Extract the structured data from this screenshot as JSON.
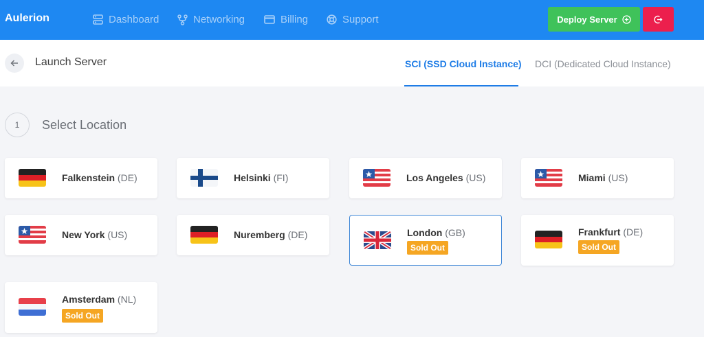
{
  "nav": {
    "brand": "Aulerion",
    "items": [
      {
        "label": "Dashboard",
        "icon": "dashboard-icon"
      },
      {
        "label": "Networking",
        "icon": "networking-icon"
      },
      {
        "label": "Billing",
        "icon": "billing-icon"
      },
      {
        "label": "Support",
        "icon": "support-icon"
      }
    ],
    "deploy_label": "Deploy Server",
    "accent": "#1e88f2"
  },
  "header": {
    "title": "Launch Server",
    "tabs": [
      {
        "label": "SCI (SSD Cloud Instance)",
        "active": true
      },
      {
        "label": "DCI (Dedicated Cloud Instance)",
        "active": false
      }
    ]
  },
  "step": {
    "number": "1",
    "title": "Select Location"
  },
  "locations": [
    {
      "city": "Falkenstein",
      "country": "(DE)",
      "flag": "DE",
      "badge": ""
    },
    {
      "city": "Helsinki",
      "country": "(FI)",
      "flag": "FI",
      "badge": ""
    },
    {
      "city": "Los Angeles",
      "country": "(US)",
      "flag": "US",
      "badge": ""
    },
    {
      "city": "Miami",
      "country": "(US)",
      "flag": "US",
      "badge": ""
    },
    {
      "city": "New York",
      "country": "(US)",
      "flag": "US",
      "badge": ""
    },
    {
      "city": "Nuremberg",
      "country": "(DE)",
      "flag": "DE",
      "badge": ""
    },
    {
      "city": "London",
      "country": "(GB)",
      "flag": "GB",
      "badge": "Sold Out",
      "selected": true
    },
    {
      "city": "Frankfurt",
      "country": "(DE)",
      "flag": "DE",
      "badge": "Sold Out"
    },
    {
      "city": "Amsterdam",
      "country": "(NL)",
      "flag": "NL",
      "badge": "Sold Out"
    }
  ]
}
